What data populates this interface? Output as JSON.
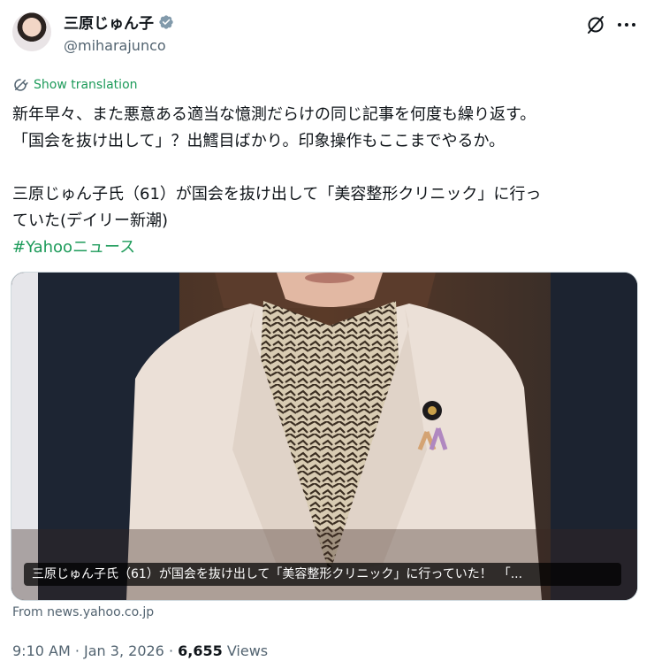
{
  "author": {
    "display_name": "三原じゅん子",
    "handle": "@miharajunco",
    "verified": true
  },
  "translate": {
    "label": "Show translation"
  },
  "tweet": {
    "line1": "新年早々、また悪意ある適当な憶測だらけの同じ記事を何度も繰り返す。",
    "line2": "「国会を抜け出して」？出鱈目ばかり。印象操作もここまでやるか。",
    "line3": "三原じゅん子氏（61）が国会を抜け出して「美容整形クリニック」に行っ",
    "line4": "ていた(デイリー新潮)",
    "hashtag": "#Yahooニュース"
  },
  "card": {
    "caption": "三原じゅん子氏（61）が国会を抜け出して「美容整形クリニック」に行っていた！　「...",
    "source": "From news.yahoo.co.jp"
  },
  "meta": {
    "time": "9:10 AM",
    "date": "Jan 3, 2026",
    "views_count": "6,655",
    "views_label": "Views"
  },
  "colors": {
    "accent": "#1d9b5a",
    "verified": "#829aab",
    "secondary_text": "#536471"
  }
}
